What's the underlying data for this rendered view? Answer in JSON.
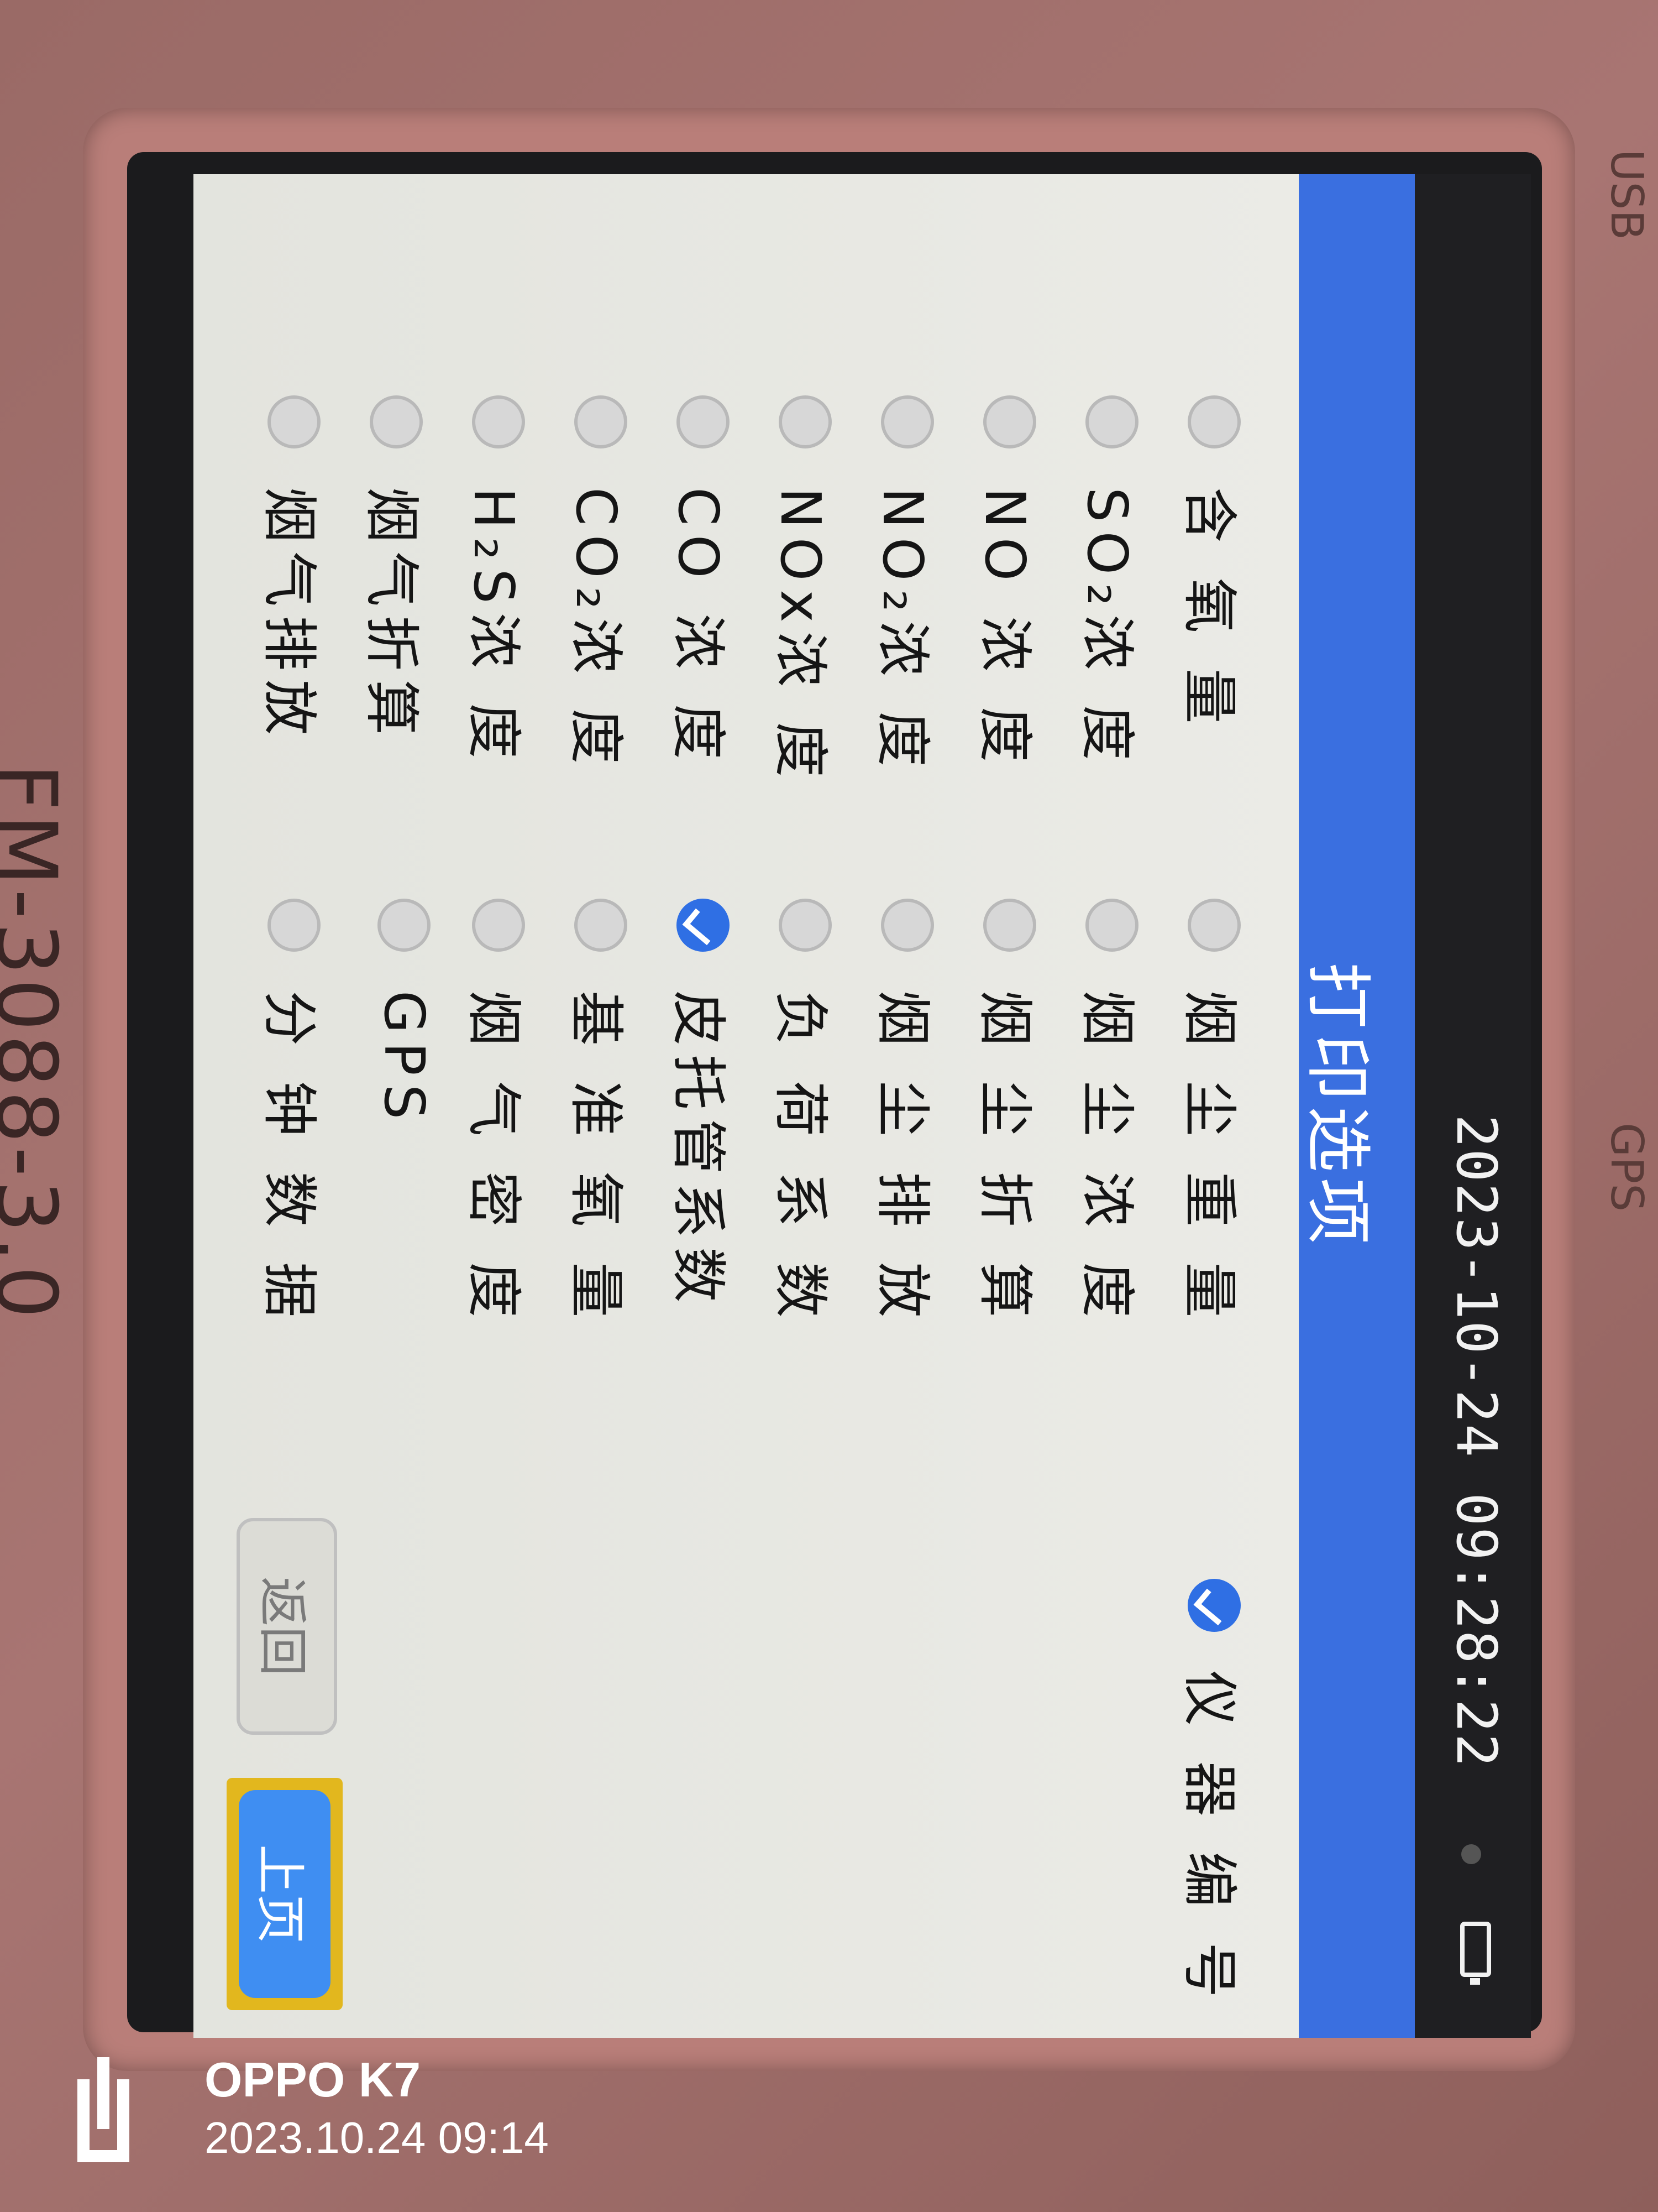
{
  "device": {
    "model_label": "FM-3088-3.0",
    "port_usb": "USB",
    "port_gps": "GPS"
  },
  "status_bar": {
    "datetime": "2023-10-24 09:28:22",
    "battery_icon": "battery-icon"
  },
  "screen": {
    "title": "打印选项",
    "options_col1": [
      {
        "label": "含 氧 量",
        "checked": false
      },
      {
        "label": "SO₂浓 度",
        "checked": false
      },
      {
        "label": "NO 浓 度",
        "checked": false
      },
      {
        "label": "NO₂浓 度",
        "checked": false
      },
      {
        "label": "NOx浓 度",
        "checked": false
      },
      {
        "label": "CO 浓 度",
        "checked": false
      },
      {
        "label": "CO₂浓 度",
        "checked": false
      },
      {
        "label": "H₂S浓 度",
        "checked": false
      },
      {
        "label": "烟气折算",
        "checked": false
      },
      {
        "label": "烟气排放",
        "checked": false
      }
    ],
    "options_col2": [
      {
        "label": "烟 尘 重 量",
        "checked": false
      },
      {
        "label": "烟 尘 浓 度",
        "checked": false
      },
      {
        "label": "烟 尘 折 算",
        "checked": false
      },
      {
        "label": "烟 尘 排 放",
        "checked": false
      },
      {
        "label": "负 荷 系 数",
        "checked": false
      },
      {
        "label": "皮托管系数",
        "checked": true
      },
      {
        "label": "基 准 氧 量",
        "checked": false
      },
      {
        "label": "烟 气 密 度",
        "checked": false
      },
      {
        "label": "GPS",
        "checked": false
      },
      {
        "label": "分 钟 数 据",
        "checked": false
      }
    ],
    "options_col3": [
      {
        "label": "仪 器 编 号",
        "checked": true
      }
    ],
    "back_label": "返回",
    "prev_page_label": "上页"
  },
  "watermark": {
    "brand": "OPPO K7",
    "timestamp": "2023.10.24 09:14"
  },
  "colors": {
    "title_bar": "#3a6fe0",
    "checked": "#2f6fe4",
    "highlight": "#e2b71e"
  }
}
